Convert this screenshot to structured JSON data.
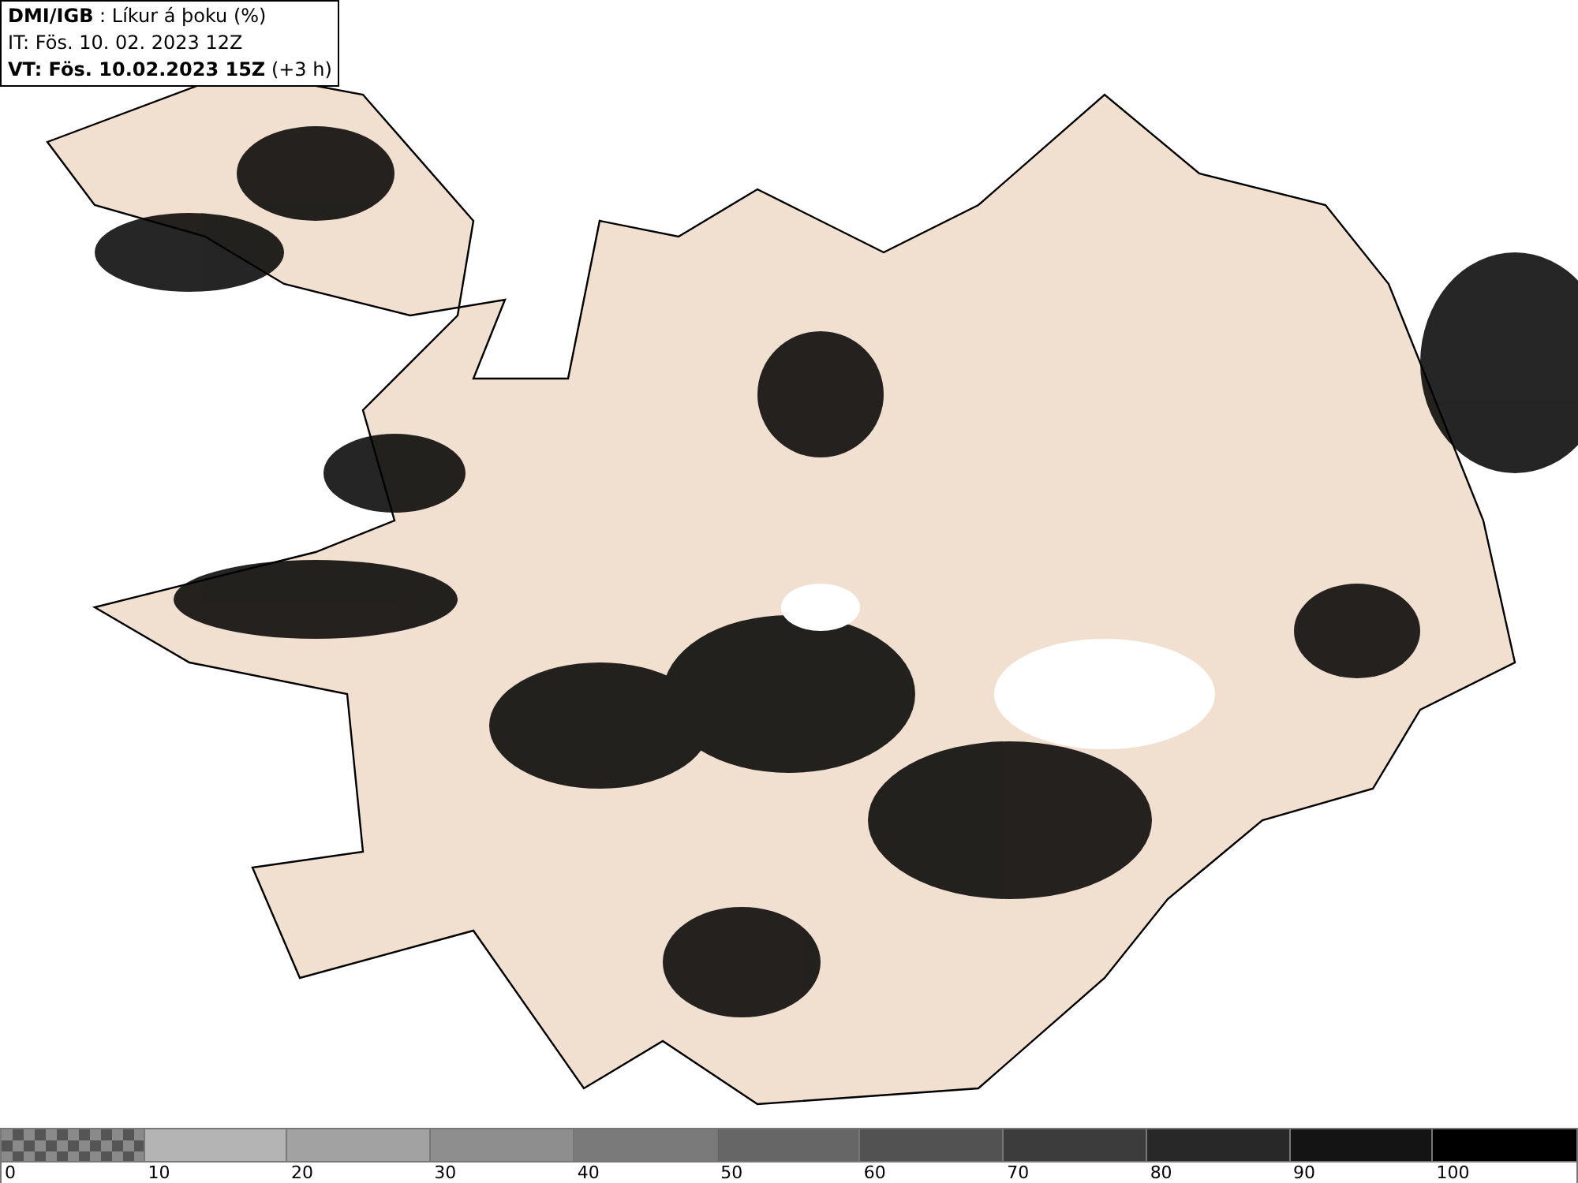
{
  "header": {
    "lines": [
      "**DMI/IGB** : Líkur á þoku (%)",
      "IT: Fös. 10. 02. 2023 12Z",
      "**VT: Fös. 10.02.2023 15Z** (+3 h)"
    ]
  },
  "legend": {
    "segments": [
      {
        "kind": "checker",
        "color": "#8a8a8a",
        "label": "0"
      },
      {
        "kind": "solid",
        "color": "#b4b4b4",
        "label": "10"
      },
      {
        "kind": "solid",
        "color": "#a2a2a2",
        "label": "20"
      },
      {
        "kind": "solid",
        "color": "#8e8e8e",
        "label": "30"
      },
      {
        "kind": "solid",
        "color": "#7a7a7a",
        "label": "40"
      },
      {
        "kind": "solid",
        "color": "#666666",
        "label": "50"
      },
      {
        "kind": "solid",
        "color": "#525252",
        "label": "60"
      },
      {
        "kind": "solid",
        "color": "#3c3c3c",
        "label": "70"
      },
      {
        "kind": "solid",
        "color": "#282828",
        "label": "80"
      },
      {
        "kind": "solid",
        "color": "#141414",
        "label": "90"
      },
      {
        "kind": "solid",
        "color": "#000000",
        "label": "100"
      }
    ]
  }
}
